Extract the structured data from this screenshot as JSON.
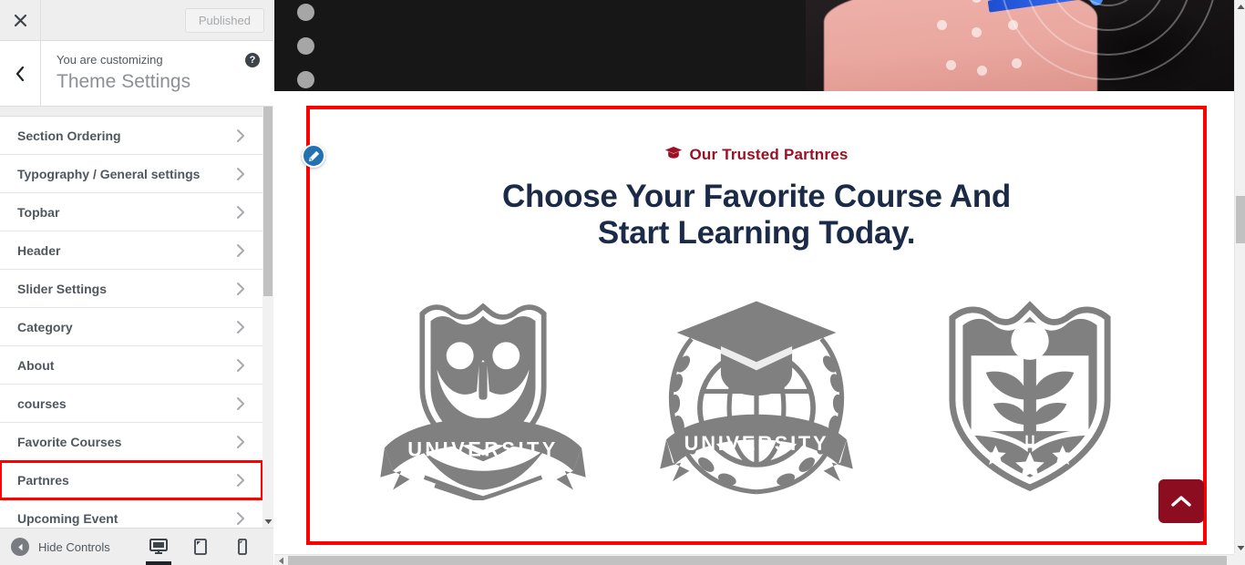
{
  "customizer": {
    "close_label": "Close",
    "publish_label": "Published",
    "back_label": "Back",
    "customizing_label": "You are customizing",
    "panel_title": "Theme Settings",
    "help_label": "?",
    "sections": [
      {
        "label": "Section Ordering",
        "highlighted": false
      },
      {
        "label": "Typography / General settings",
        "highlighted": false
      },
      {
        "label": "Topbar",
        "highlighted": false
      },
      {
        "label": "Header",
        "highlighted": false
      },
      {
        "label": "Slider Settings",
        "highlighted": false
      },
      {
        "label": "Category",
        "highlighted": false
      },
      {
        "label": "About",
        "highlighted": false
      },
      {
        "label": "courses",
        "highlighted": false
      },
      {
        "label": "Favorite Courses",
        "highlighted": false
      },
      {
        "label": "Partnres",
        "highlighted": true
      },
      {
        "label": "Upcoming Event",
        "highlighted": false
      }
    ],
    "footer": {
      "hide_controls_label": "Hide Controls",
      "devices": [
        {
          "name": "desktop",
          "active": true
        },
        {
          "name": "tablet",
          "active": false
        },
        {
          "name": "mobile",
          "active": false
        }
      ]
    }
  },
  "preview": {
    "slider_dots": [
      1,
      2,
      3
    ],
    "edit_shortcut_label": "Edit",
    "partners_section": {
      "subtitle": "Our Trusted Partnres",
      "subtitle_icon": "graduation-cap-icon",
      "heading_line1": "Choose Your Favorite Course And",
      "heading_line2": "Start Learning Today.",
      "logos": [
        {
          "name": "owl-shield-university-crest",
          "banner_text": "UNIVERSITY"
        },
        {
          "name": "graduation-globe-laurel-crest",
          "banner_text": "UNIVERSITY"
        },
        {
          "name": "book-shield-stars-crest",
          "banner_text": ""
        }
      ]
    },
    "scroll_to_top_label": "Scroll to top"
  },
  "colors": {
    "accent_red": "#9d0f22",
    "heading_navy": "#1b2b47",
    "logo_gray": "#808080",
    "annotation_red": "#ff0000",
    "edit_blue": "#2271b1",
    "totop_red": "#8c0d20"
  }
}
